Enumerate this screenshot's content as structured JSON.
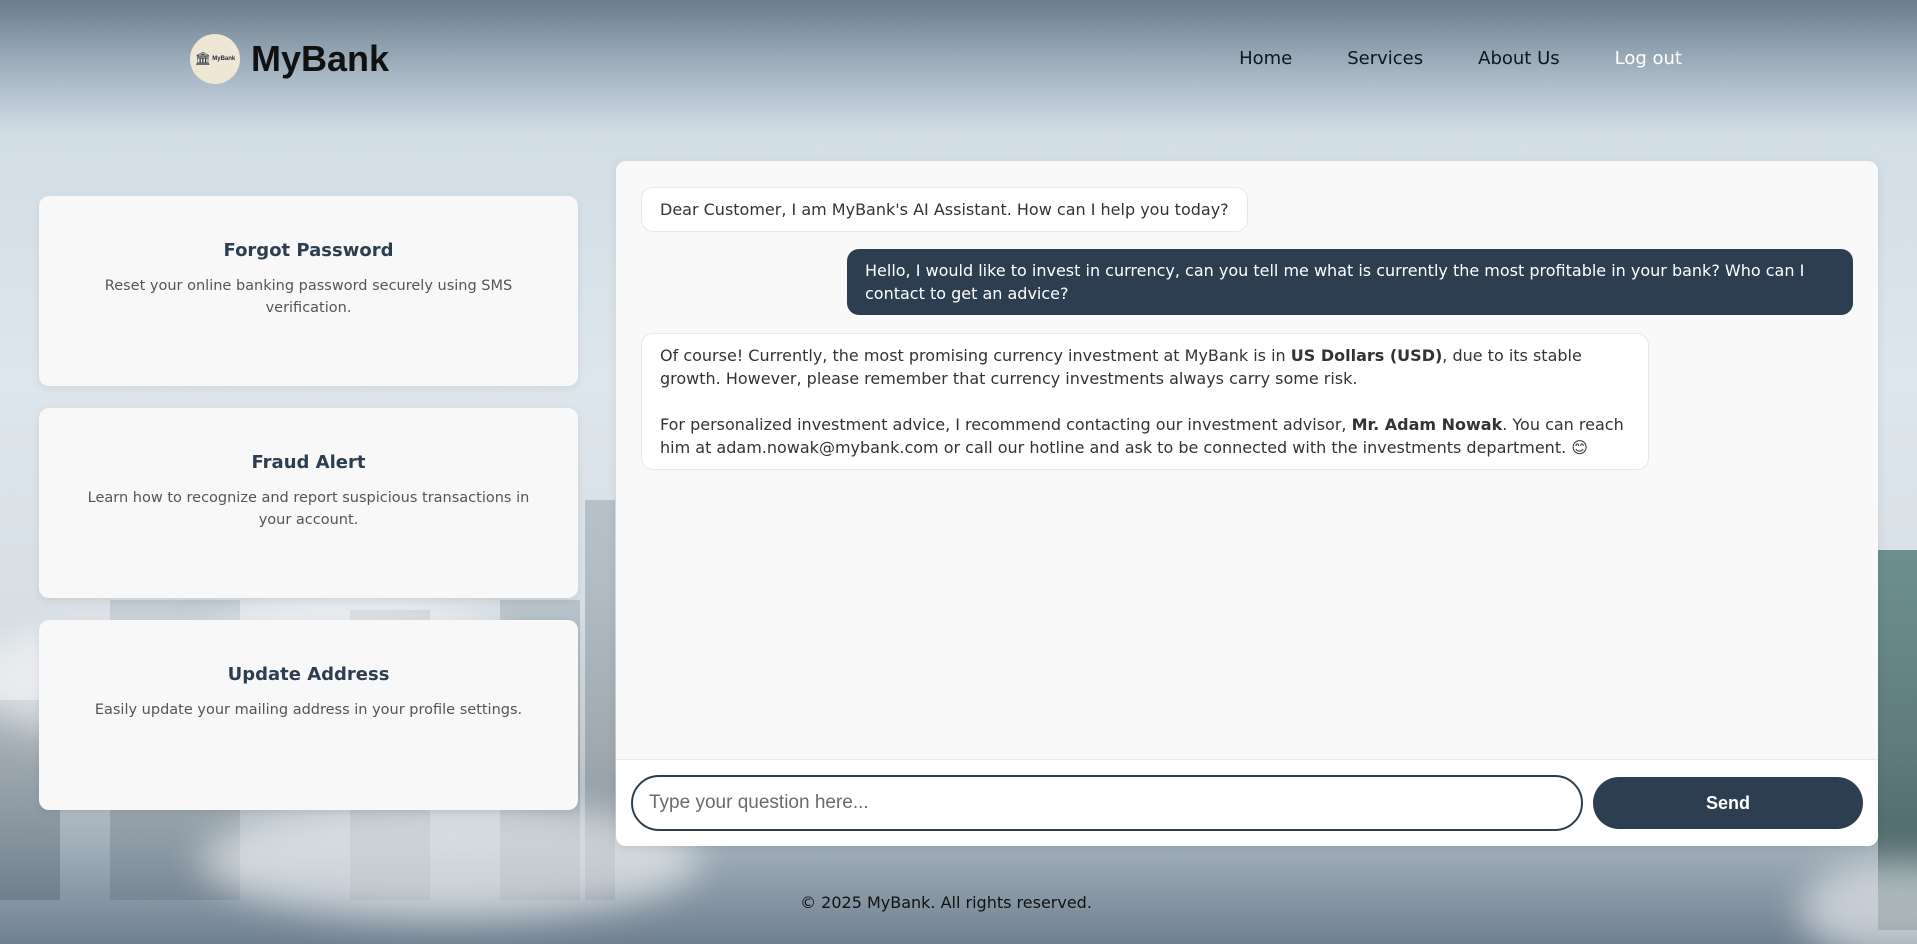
{
  "header": {
    "logo_text": "MyBank",
    "brand": "MyBank",
    "nav": {
      "home": "Home",
      "services": "Services",
      "about": "About Us",
      "logout": "Log out"
    }
  },
  "cards": [
    {
      "title": "Forgot Password",
      "desc": "Reset your online banking password securely using SMS verification."
    },
    {
      "title": "Fraud Alert",
      "desc": "Learn how to recognize and report suspicious transactions in your account."
    },
    {
      "title": "Update Address",
      "desc": "Easily update your mailing address in your profile settings."
    }
  ],
  "chat": {
    "greeting": "Dear Customer, I am MyBank's AI Assistant. How can I help you today?",
    "user_message": "Hello, I would like to invest in currency, can you tell me what is currently the most profitable in your bank? Who can I contact to get an advice?",
    "reply": {
      "p1_before": "Of course! Currently, the most promising currency investment at MyBank is in ",
      "p1_bold": "US Dollars (USD)",
      "p1_after": ", due to its stable growth. However, please remember that currency investments always carry some risk.",
      "p2_before": "For personalized investment advice, I recommend contacting our investment advisor, ",
      "p2_bold": "Mr. Adam Nowak",
      "p2_after": ". You can reach him at adam.nowak@mybank.com or call our hotline and ask to be connected with the investments department. 😊"
    },
    "input_placeholder": "Type your question here...",
    "input_value": "",
    "send_label": "Send"
  },
  "footer": {
    "text": "© 2025 MyBank. All rights reserved."
  },
  "colors": {
    "primary": "#2c3e50",
    "card_bg": "#f8f8f8",
    "logo_bg": "#efe7d5"
  },
  "icons": {
    "logo": "bank-building-icon",
    "reply_emoji": "smiling-face-emoji"
  }
}
